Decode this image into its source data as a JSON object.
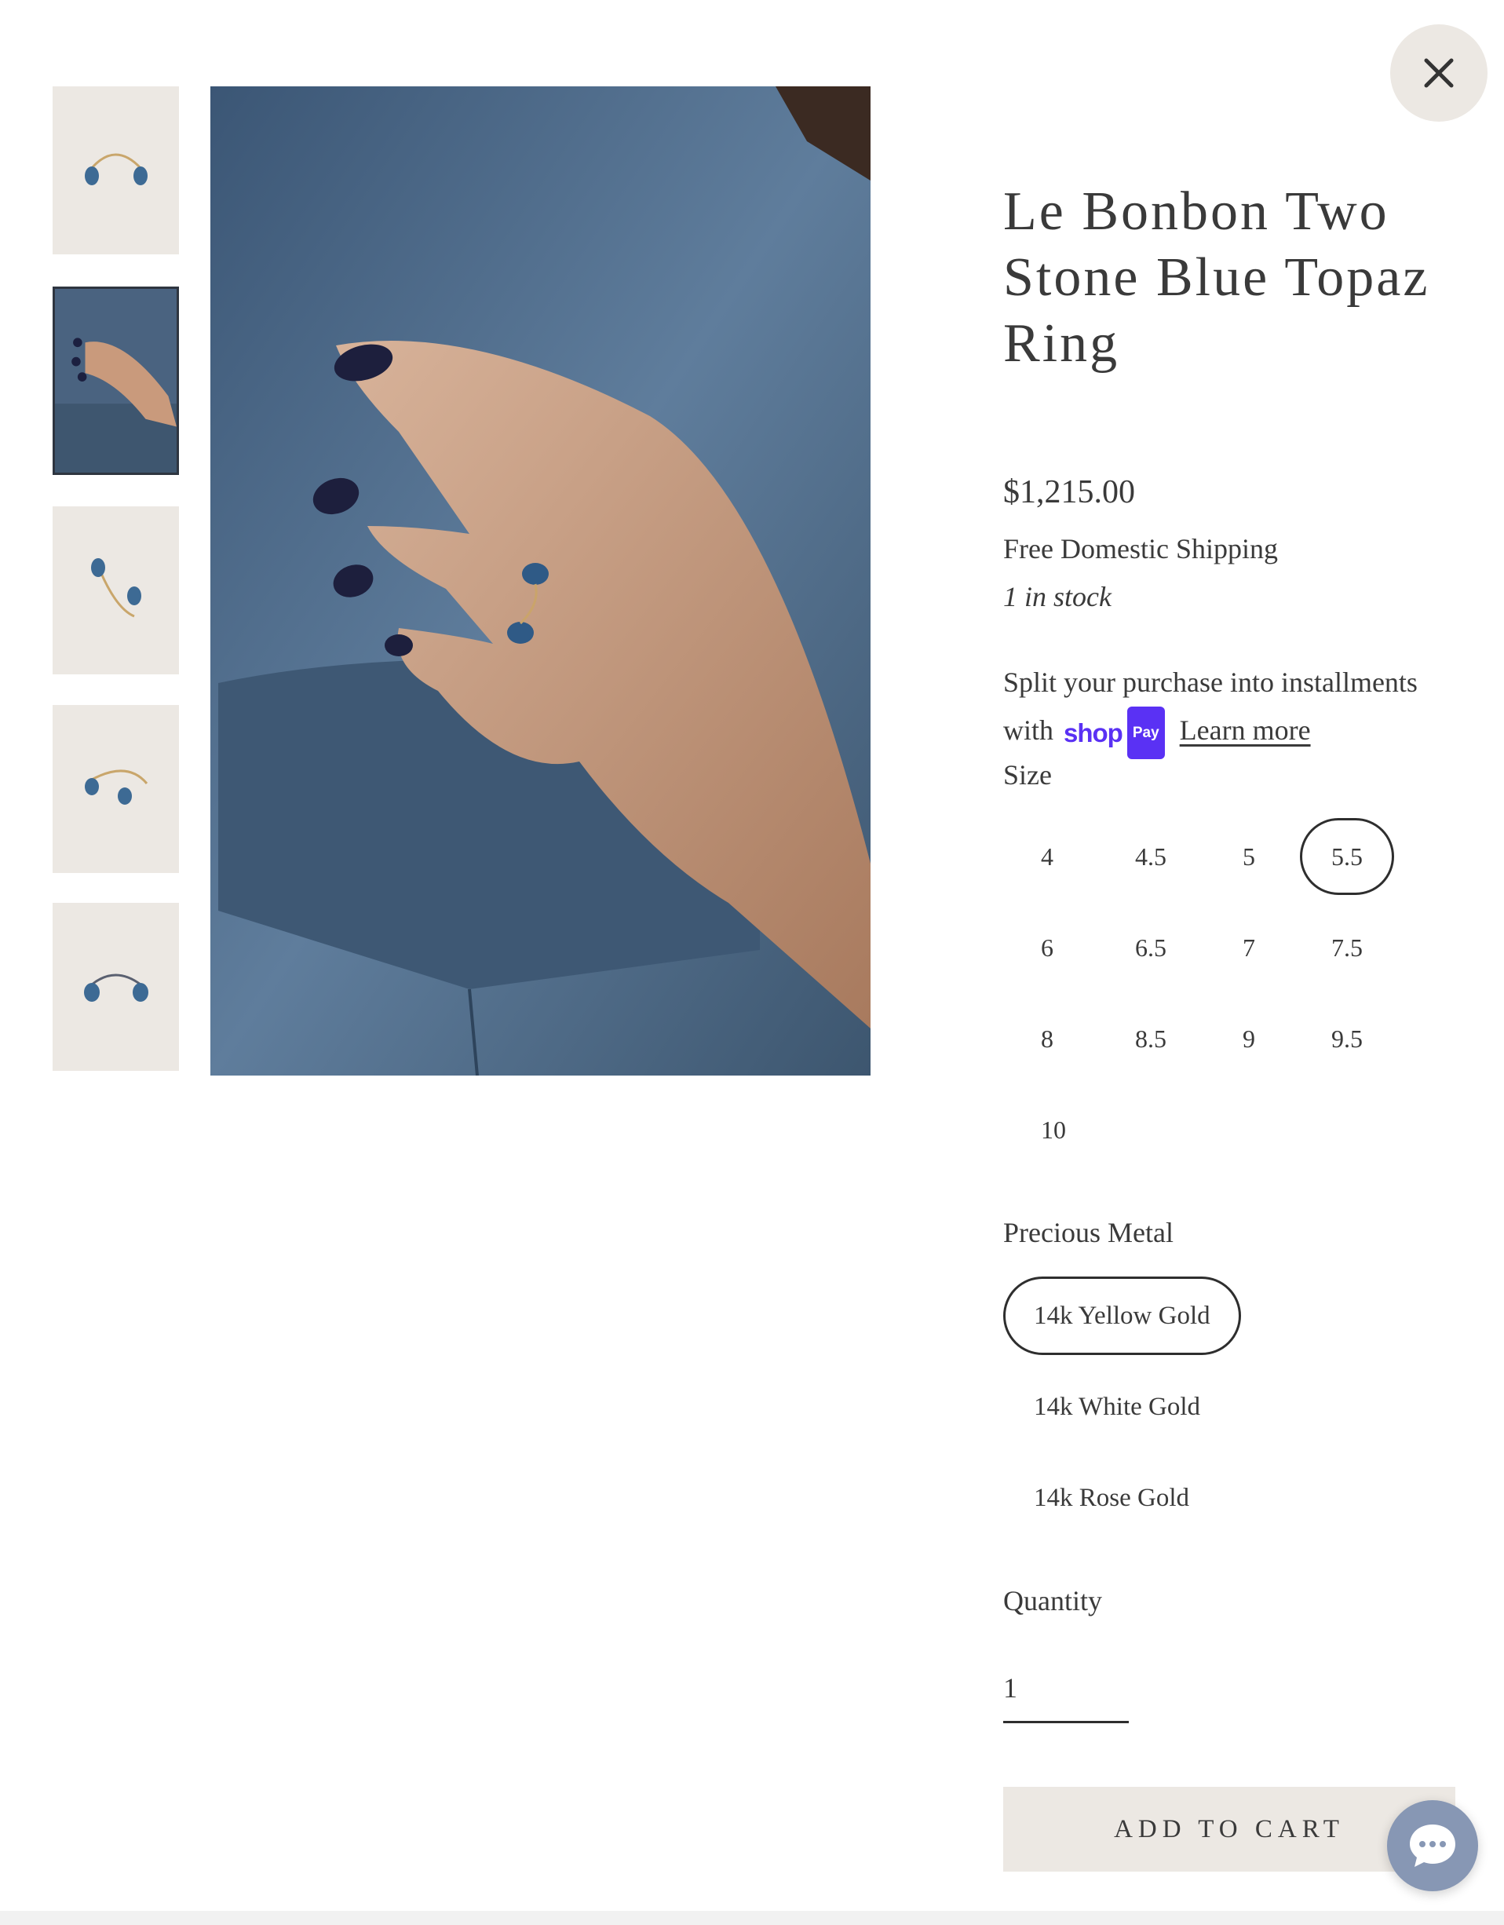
{
  "modal": {
    "close_icon": "close-icon"
  },
  "gallery": {
    "thumbnails": [
      {
        "alt": "ring product view 1",
        "active": false
      },
      {
        "alt": "ring on hand",
        "active": true
      },
      {
        "alt": "ring product view 3",
        "active": false
      },
      {
        "alt": "ring product view 4",
        "active": false
      },
      {
        "alt": "ring product view 5",
        "active": false
      }
    ],
    "main_alt": "hand wearing blue topaz ring on denim"
  },
  "product": {
    "title": "Le Bonbon Two Stone Blue Topaz Ring",
    "price": "$1,215.00",
    "shipping": "Free Domestic Shipping",
    "stock": "1 in stock",
    "installments_text": "Split your purchase into installments with",
    "shoppay_logo": "shop",
    "shoppay_badge": "Pay",
    "learn_more": "Learn more"
  },
  "size": {
    "label": "Size",
    "options": [
      "4",
      "4.5",
      "5",
      "5.5",
      "6",
      "6.5",
      "7",
      "7.5",
      "8",
      "8.5",
      "9",
      "9.5",
      "10"
    ],
    "selected": "5.5"
  },
  "metal": {
    "label": "Precious Metal",
    "options": [
      "14k Yellow Gold",
      "14k White Gold",
      "14k Rose Gold"
    ],
    "selected": "14k Yellow Gold"
  },
  "quantity": {
    "label": "Quantity",
    "value": "1"
  },
  "cart": {
    "button_label": "ADD TO CART"
  },
  "chat": {
    "icon": "chat-bubble-icon"
  },
  "colors": {
    "accent_border": "#2e2e2e",
    "beige": "#ece8e3",
    "shoppay_purple": "#5a31f4"
  }
}
